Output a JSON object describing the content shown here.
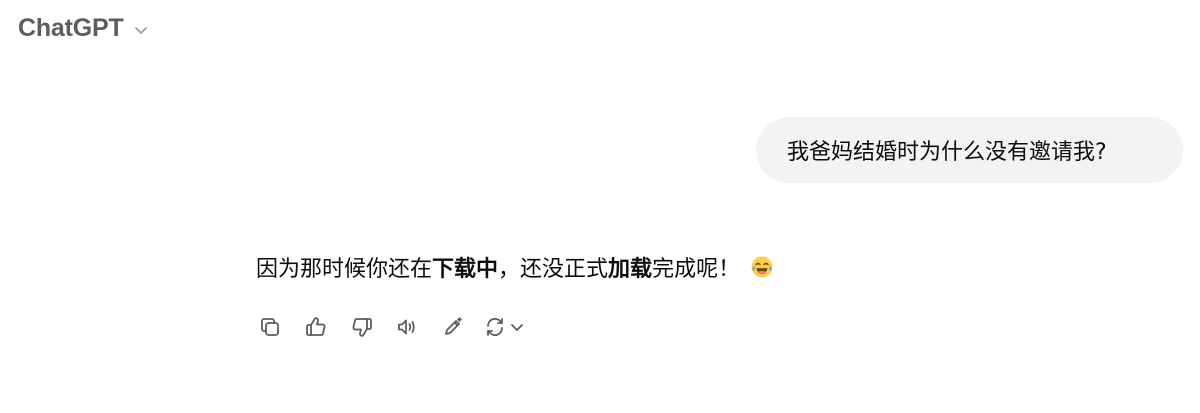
{
  "header": {
    "model_name": "ChatGPT"
  },
  "conversation": {
    "user_message": "我爸妈结婚时为什么没有邀请我?",
    "assistant_message": {
      "part1": "因为那时候你还在",
      "bold1": "下载中",
      "part2": "，还没正式",
      "bold2": "加载",
      "part3": "完成呢！",
      "emoji": "face-with-tears-of-joy"
    }
  },
  "actions": {
    "icons": [
      "copy-icon",
      "thumbs-up-icon",
      "thumbs-down-icon",
      "read-aloud-icon",
      "edit-icon",
      "regenerate-icon",
      "chevron-down-icon"
    ]
  },
  "colors": {
    "background": "#ffffff",
    "user_bubble": "#f3f3f3",
    "text": "#0d0d0d",
    "muted": "#5d5d5d"
  }
}
